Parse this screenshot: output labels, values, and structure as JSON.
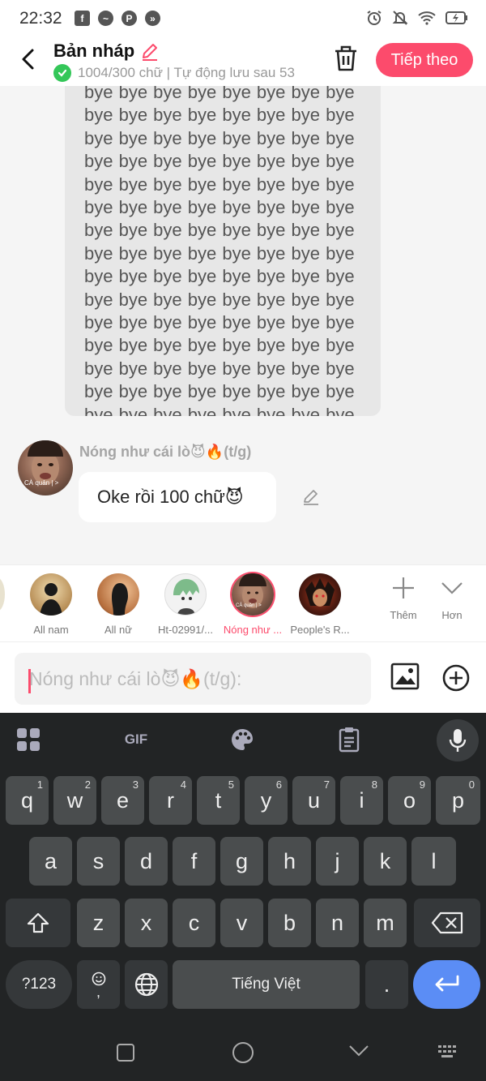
{
  "status_bar": {
    "time": "22:32",
    "notification_icons": [
      "facebook-icon",
      "messenger-icon",
      "pinterest-icon",
      "app-icon"
    ],
    "status_icons": [
      "alarm-icon",
      "mute-icon",
      "wifi-icon",
      "battery-icon"
    ]
  },
  "header": {
    "title": "Bản nháp",
    "subtitle": "1004/300 chữ | Tự động lưu sau 53",
    "next_label": "Tiếp theo",
    "accent_color": "#fc4b6c"
  },
  "chat": {
    "draft_text": "bye bye bye bye bye bye bye bye bye bye bye bye bye bye bye bye bye bye bye bye bye bye bye bye bye bye bye bye bye bye bye bye bye bye bye bye bye bye bye bye bye bye bye bye bye bye bye bye bye bye bye bye bye bye bye bye bye bye bye bye bye bye bye bye bye bye bye bye bye bye bye bye bye bye bye bye bye bye bye bye bye bye bye bye bye bye bye bye bye bye bye bye bye bye bye bye bye bye bye bye bye bye bye bye bye bye bye bye bye bye bye bye bye bye bye bye bye bye bye bye bye",
    "draft_emoji": "❤️",
    "sender_name": "Nóng như cái lò😈🔥(t/g)",
    "avatar_caption": "CÀ quản | >",
    "message": "Oke rồi 100 chữ😈"
  },
  "characters": [
    {
      "label": "All nam"
    },
    {
      "label": "All nữ"
    },
    {
      "label": "Ht-02991/..."
    },
    {
      "label": "Nóng như ...",
      "active": true,
      "caption": "CÀ quản | >"
    },
    {
      "label": "People's R..."
    }
  ],
  "strip_tools": {
    "add_label": "Thêm",
    "more_label": "Hơn"
  },
  "input": {
    "placeholder": "Nóng như cái lò😈🔥(t/g):"
  },
  "keyboard": {
    "row1": [
      [
        "q",
        "1"
      ],
      [
        "w",
        "2"
      ],
      [
        "e",
        "3"
      ],
      [
        "r",
        "4"
      ],
      [
        "t",
        "5"
      ],
      [
        "y",
        "6"
      ],
      [
        "u",
        "7"
      ],
      [
        "i",
        "8"
      ],
      [
        "o",
        "9"
      ],
      [
        "p",
        "0"
      ]
    ],
    "row2": [
      "a",
      "s",
      "d",
      "f",
      "g",
      "h",
      "j",
      "k",
      "l"
    ],
    "row3": [
      "z",
      "x",
      "c",
      "v",
      "b",
      "n",
      "m"
    ],
    "symbols_label": "?123",
    "comma_label": ",",
    "space_label": "Tiếng Việt",
    "period_label": ".",
    "gif_label": "GIF",
    "enter_color": "#5b8df5"
  }
}
